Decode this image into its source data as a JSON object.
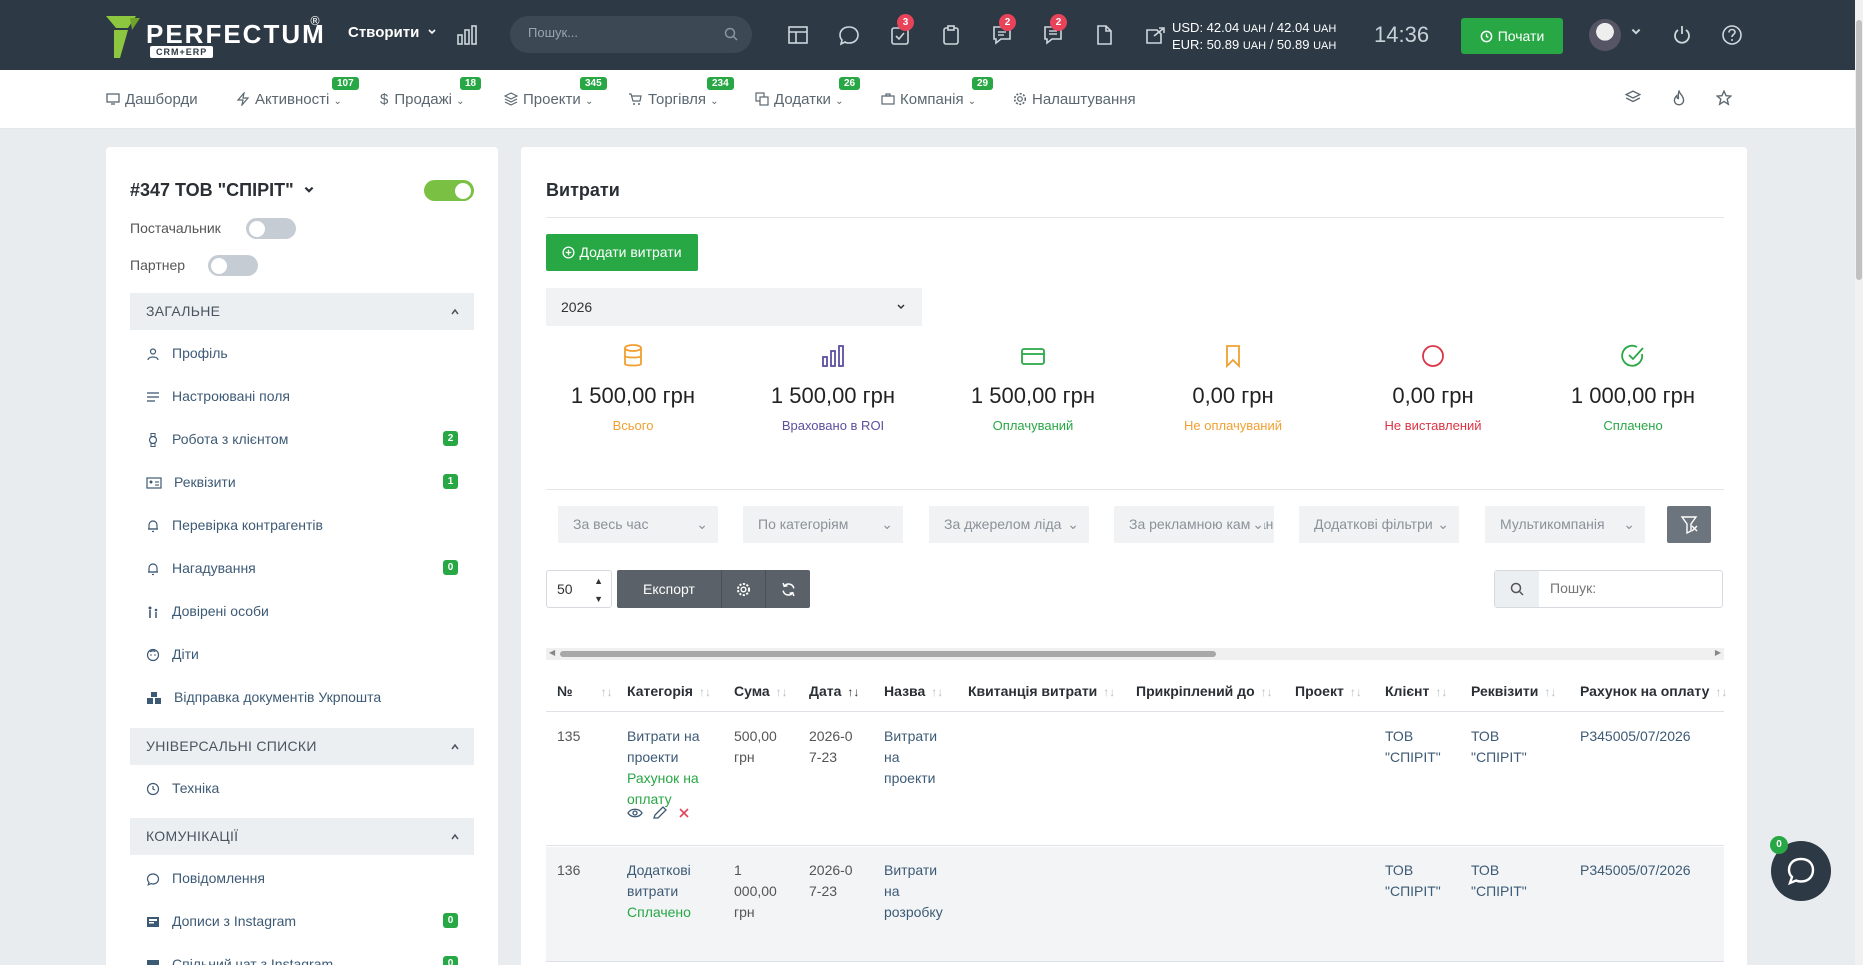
{
  "topbar": {
    "brand": "PERFECTUM",
    "brand_reg": "®",
    "brand_sub": "CRM+ERP",
    "create_label": "Створити",
    "search_placeholder": "Пошук...",
    "badges": {
      "tasks": "3",
      "chat": "2",
      "messages": "2"
    },
    "currency_usd": "USD: 42.04",
    "currency_usd_rest": "/ 42.04",
    "currency_eur": "EUR: 50.89",
    "currency_eur_rest": "/ 50.89",
    "currency_unit": "UAH",
    "time": "14:36",
    "start_label": "Почати"
  },
  "nav": [
    {
      "label": "Дашборди",
      "badge": ""
    },
    {
      "label": "Активності",
      "badge": "107"
    },
    {
      "label": "Продажі",
      "badge": "18"
    },
    {
      "label": "Проекти",
      "badge": "345"
    },
    {
      "label": "Торгівля",
      "badge": "234"
    },
    {
      "label": "Додатки",
      "badge": "26"
    },
    {
      "label": "Компанія",
      "badge": "29"
    },
    {
      "label": "Налаштування",
      "badge": ""
    }
  ],
  "left": {
    "title": "#347 ТОВ \"СПІРІТ\"",
    "supplier_label": "Постачальник",
    "partner_label": "Партнер",
    "sections": {
      "general": "ЗАГАЛЬНЕ",
      "lists": "УНІВЕРСАЛЬНІ СПИСКИ",
      "comms": "КОМУНІКАЦІЇ"
    },
    "items": [
      {
        "label": "Профіль",
        "badge": "",
        "icon": "user-icon"
      },
      {
        "label": "Настроювані поля",
        "badge": "",
        "icon": "lines-icon"
      },
      {
        "label": "Робота з клієнтом",
        "badge": "2",
        "icon": "watch-icon"
      },
      {
        "label": "Реквізити",
        "badge": "1",
        "icon": "id-card-icon"
      },
      {
        "label": "Перевірка контрагентів",
        "badge": "",
        "icon": "bell-icon"
      },
      {
        "label": "Нагадування",
        "badge": "0",
        "icon": "bell-icon"
      },
      {
        "label": "Довірені особи",
        "badge": "",
        "icon": "persons-icon"
      },
      {
        "label": "Діти",
        "badge": "",
        "icon": "baby-icon"
      },
      {
        "label": "Відправка документів Укрпошта",
        "badge": "",
        "icon": "boxes-icon"
      },
      {
        "label": "Техніка",
        "badge": "",
        "icon": "clock-icon"
      },
      {
        "label": "Повідомлення",
        "badge": "",
        "icon": "comment-icon"
      },
      {
        "label": "Дописи з Instagram",
        "badge": "0",
        "icon": "instagram-icon"
      },
      {
        "label": "Спільний чат з Instagram",
        "badge": "0",
        "icon": "instagram-icon"
      }
    ]
  },
  "main": {
    "title": "Витрати",
    "add_label": "Додати витрати",
    "year": "2026",
    "stats": [
      {
        "value": "1 500,00 грн",
        "label": "Всього",
        "color": "#f0a030"
      },
      {
        "value": "1 500,00 грн",
        "label": "Враховано в ROI",
        "color": "#5b4fa0"
      },
      {
        "value": "1 500,00 грн",
        "label": "Оплачуваний",
        "color": "#28a745"
      },
      {
        "value": "0,00 грн",
        "label": "Не оплачуваний",
        "color": "#f0a030"
      },
      {
        "value": "0,00 грн",
        "label": "Не виставлений",
        "color": "#dc3545"
      },
      {
        "value": "1 000,00 грн",
        "label": "Сплачено",
        "color": "#28a745"
      }
    ],
    "filters": [
      "За весь час",
      "По категоріям",
      "За джерелом ліда",
      "За рекламною кампанією",
      "Додаткові фільтри",
      "Мультикомпанія"
    ],
    "per_page": "50",
    "export_label": "Експорт",
    "search_placeholder": "Пошук:",
    "columns": [
      "№",
      "Категорія",
      "Сума",
      "Дата",
      "Назва",
      "Квитанція витрати",
      "Прикріплений до",
      "Проект",
      "Клієнт",
      "Реквізити",
      "Рахунок на оплату"
    ],
    "rows": [
      {
        "num": "135",
        "category": "Витрати на проекти",
        "status": "Рахунок на оплату",
        "sum": "500,00 грн",
        "date": "2026-07-23",
        "name": "Витрати на проекти",
        "client": "ТОВ \"СПІРІТ\"",
        "requisites": "ТОВ \"СПІРІТ\"",
        "invoice": "P345005/07/2026"
      },
      {
        "num": "136",
        "category": "Додаткові витрати",
        "status": "Сплачено",
        "sum": "1 000,00 грн",
        "date": "2026-07-23",
        "name": "Витрати на розробку",
        "client": "ТОВ \"СПІРІТ\"",
        "requisites": "ТОВ \"СПІРІТ\"",
        "invoice": "P345005/07/2026"
      }
    ]
  },
  "chat_badge": "0"
}
